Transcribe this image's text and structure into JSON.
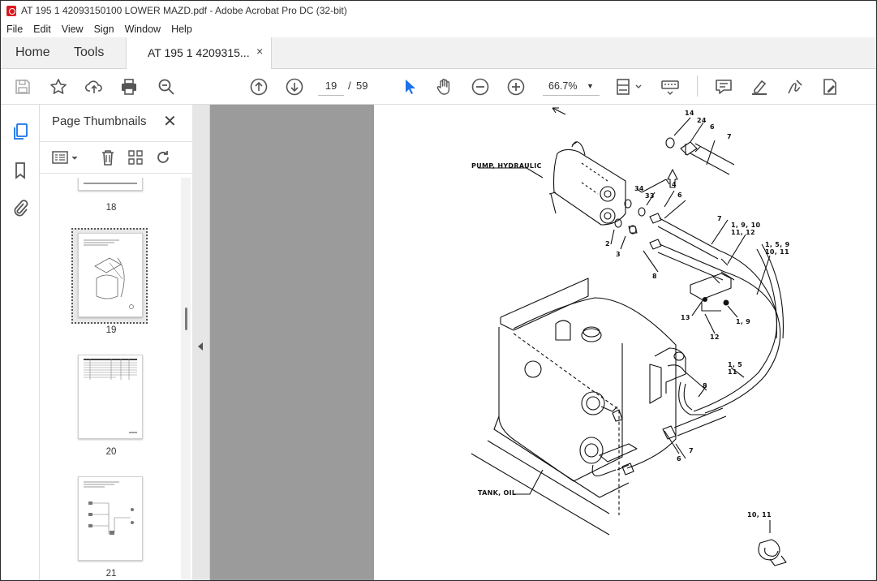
{
  "window": {
    "title": "AT 195 1 42093150100 LOWER MAZD.pdf - Adobe Acrobat Pro DC (32-bit)"
  },
  "menu": [
    "File",
    "Edit",
    "View",
    "Sign",
    "Window",
    "Help"
  ],
  "tabs": {
    "home": "Home",
    "tools": "Tools",
    "document": "AT 195 1 4209315...",
    "close_glyph": "×"
  },
  "toolbar": {
    "page_current": "19",
    "page_separator": "/",
    "page_total": "59",
    "zoom": "66.7%",
    "icons": [
      "save-icon",
      "star-icon",
      "upload-icon",
      "print-icon",
      "find-icon",
      "prev-page-icon",
      "next-page-icon",
      "select-arrow-icon",
      "hand-icon",
      "zoom-out-icon",
      "zoom-in-icon",
      "fit-page-icon",
      "keyboard-icon",
      "comment-icon",
      "highlight-icon",
      "sign-icon",
      "edit-pdf-icon"
    ]
  },
  "thumbnail_panel": {
    "title": "Page Thumbnails",
    "close_glyph": "✕",
    "pages": [
      {
        "number": "18"
      },
      {
        "number": "19",
        "selected": true
      },
      {
        "number": "20"
      },
      {
        "number": "21"
      }
    ]
  },
  "diagram": {
    "labels": {
      "pump": "PUMP, HYDRAULIC",
      "tank": "TANK, OIL",
      "c14": "14",
      "c24": "24",
      "c6a": "6",
      "c7a": "7",
      "c4": "4",
      "c34": "34",
      "c33": "33",
      "c6b": "6",
      "c7b": "7",
      "c2": "2",
      "c3": "3",
      "c8a": "8",
      "c1911": "1, 9, 10",
      "c1112": "11, 12",
      "c159": "1, 5, 9",
      "c1011a": "10, 11",
      "c13": "13",
      "c12": "12",
      "c19": "1, 9",
      "c15": "1, 5",
      "c11": "11",
      "c8b": "8",
      "c7c": "7",
      "c6c": "6",
      "c1011b": "10, 11"
    }
  }
}
